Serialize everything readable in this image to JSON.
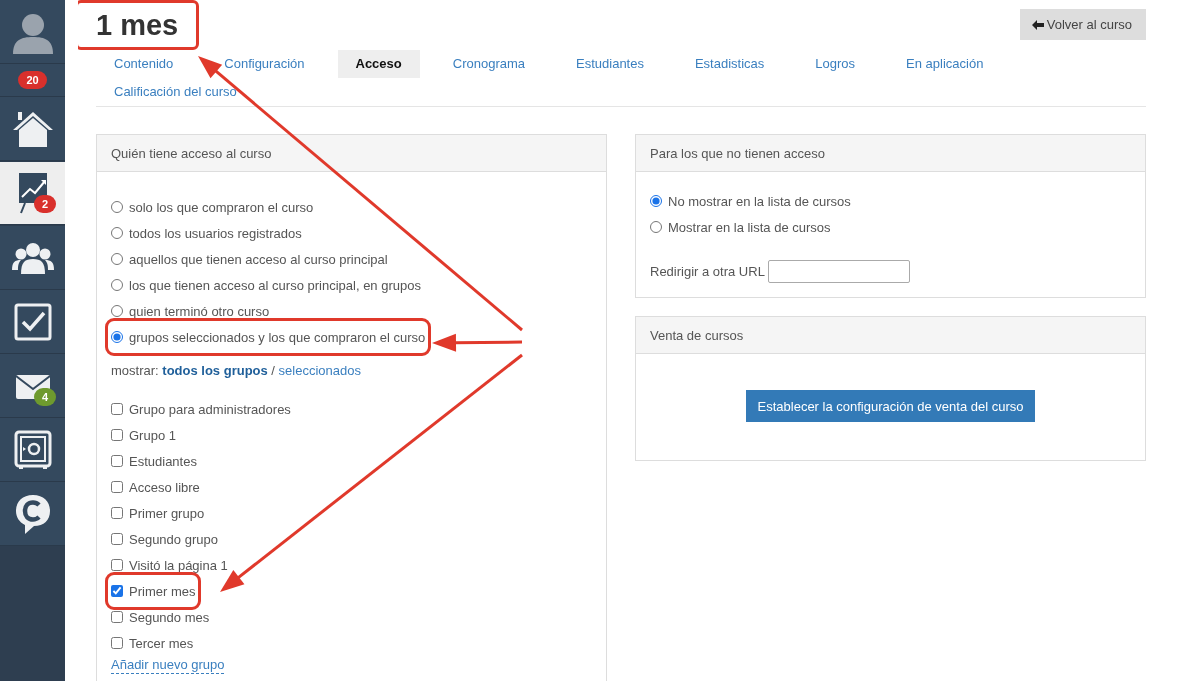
{
  "sidebar": {
    "items": [
      {
        "kind": "avatar",
        "selected": false
      },
      {
        "kind": "counter",
        "selected": false,
        "badge": {
          "text": "20",
          "color": "#d9302c"
        }
      },
      {
        "kind": "home",
        "selected": false
      },
      {
        "kind": "chart",
        "selected": true,
        "badge": {
          "text": "2",
          "color": "#d9302c"
        }
      },
      {
        "kind": "people",
        "selected": false
      },
      {
        "kind": "tasks",
        "selected": false
      },
      {
        "kind": "mail",
        "selected": false,
        "badge": {
          "text": "4",
          "color": "#6e9a2e"
        }
      },
      {
        "kind": "safe",
        "selected": false
      },
      {
        "kind": "chat",
        "selected": false
      }
    ]
  },
  "title": {
    "text": "1 mes",
    "highlighted": true
  },
  "back_button": {
    "label": "Volver al curso"
  },
  "tabs": [
    {
      "label": "Contenido",
      "selected": false
    },
    {
      "label": "Configuración",
      "selected": false
    },
    {
      "label": "Acceso",
      "selected": true
    },
    {
      "label": "Cronograma",
      "selected": false
    },
    {
      "label": "Estudiantes",
      "selected": false
    },
    {
      "label": "Estadisticas",
      "selected": false
    },
    {
      "label": "Logros",
      "selected": false
    },
    {
      "label": "En aplicación",
      "selected": false
    },
    {
      "label": "Calificación del curso",
      "selected": false
    }
  ],
  "access_panel": {
    "title": "Quién tiene acceso al curso",
    "options": [
      {
        "label": "solo los que compraron el curso",
        "selected": false,
        "highlighted": false
      },
      {
        "label": "todos los usuarios registrados",
        "selected": false,
        "highlighted": false
      },
      {
        "label": "aquellos que tienen acceso al curso principal",
        "selected": false,
        "highlighted": false
      },
      {
        "label": "los que tienen acceso al curso principal, en grupos",
        "selected": false,
        "highlighted": false
      },
      {
        "label": "quien terminó otro curso",
        "selected": false,
        "highlighted": false
      },
      {
        "label": "grupos seleccionados y los que compraron el curso",
        "selected": true,
        "highlighted": true
      }
    ],
    "filter": {
      "label": "mostrar:",
      "separator": "/",
      "links": [
        {
          "label": "todos los grupos",
          "selected": true
        },
        {
          "label": "seleccionados",
          "selected": false
        }
      ]
    },
    "groups": [
      {
        "label": "Grupo para administradores",
        "checked": false,
        "highlighted": false
      },
      {
        "label": "Grupo 1",
        "checked": false,
        "highlighted": false
      },
      {
        "label": "Estudiantes",
        "checked": false,
        "highlighted": false
      },
      {
        "label": "Acceso libre",
        "checked": false,
        "highlighted": false
      },
      {
        "label": "Primer grupo",
        "checked": false,
        "highlighted": false
      },
      {
        "label": "Segundo grupo",
        "checked": false,
        "highlighted": false
      },
      {
        "label": "Visitó la página 1",
        "checked": false,
        "highlighted": false
      },
      {
        "label": "Primer mes",
        "checked": true,
        "highlighted": true
      },
      {
        "label": "Segundo mes",
        "checked": false,
        "highlighted": false
      },
      {
        "label": "Tercer mes",
        "checked": false,
        "highlighted": false
      }
    ],
    "add_link": "Añadir nuevo grupo"
  },
  "visibility_panel": {
    "title": "Para los que no tienen acceso",
    "options": [
      {
        "label": "No mostrar en la lista de cursos",
        "selected": true
      },
      {
        "label": "Mostrar en la lista de cursos",
        "selected": false
      }
    ],
    "redirect_label": "Redirigir a otra URL"
  },
  "sales_panel": {
    "title": "Venta de cursos",
    "button": "Establecer la configuración de venta del curso"
  }
}
